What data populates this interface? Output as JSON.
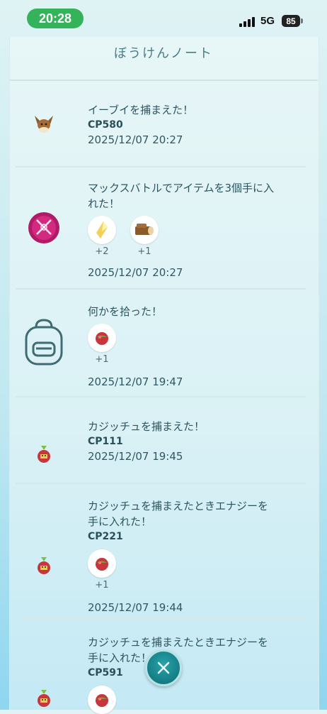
{
  "status_bar": {
    "time": "20:28",
    "network": "5G",
    "battery": "85"
  },
  "header": {
    "title": "ぼうけんノート"
  },
  "entries": [
    {
      "headline": "イーブイを捕まえた！",
      "cp": "CP580",
      "date": "2025/12/07 20:27",
      "icon": "eevee-icon"
    },
    {
      "headline_line1": "マックスバトルでアイテムを3個手に入",
      "headline_line2": "れた！",
      "items": [
        {
          "icon": "max-particle-icon",
          "count": "+2"
        },
        {
          "icon": "wooden-log-icon",
          "count": "+1"
        }
      ],
      "date": "2025/12/07 20:27",
      "icon": "max-battle-badge-icon"
    },
    {
      "headline": "何かを拾った！",
      "items": [
        {
          "icon": "apple-candy-icon",
          "count": "+1"
        }
      ],
      "date": "2025/12/07 19:47",
      "icon": "backpack-icon"
    },
    {
      "headline": "カジッチュを捕まえた！",
      "cp": "CP111",
      "date": "2025/12/07 19:45",
      "icon": "applin-icon"
    },
    {
      "headline_line1": "カジッチュを捕まえたときエナジーを",
      "headline_line2": "手に入れた！",
      "cp": "CP221",
      "items": [
        {
          "icon": "apple-candy-icon",
          "count": "+1"
        }
      ],
      "date": "2025/12/07 19:44",
      "icon": "applin-icon"
    },
    {
      "headline_line1": "カジッチュを捕まえたときエナジーを",
      "headline_line2": "手に入れた！",
      "cp": "CP591",
      "items": [
        {
          "icon": "apple-candy-icon",
          "count": ""
        }
      ],
      "icon": "applin-icon"
    }
  ],
  "close_button": {
    "icon": "close-icon"
  }
}
